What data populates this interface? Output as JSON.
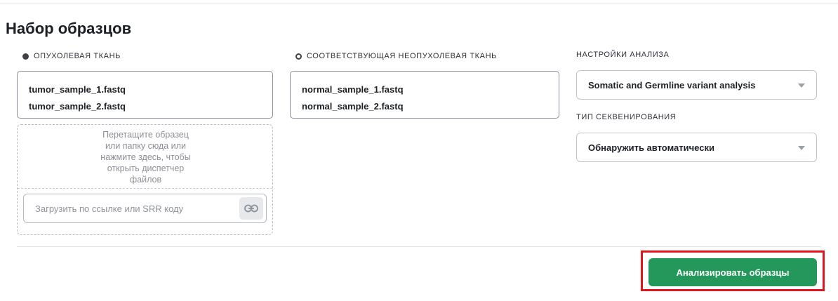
{
  "page": {
    "title": "Набор образцов"
  },
  "tumor": {
    "label": "ОПУХОЛЕВАЯ ТКАНЬ",
    "files": [
      "tumor_sample_1.fastq",
      "tumor_sample_2.fastq"
    ]
  },
  "normal": {
    "label": "СООТВЕТСТВУЮЩАЯ НЕОПУХОЛЕВАЯ ТКАНЬ",
    "files": [
      "normal_sample_1.fastq",
      "normal_sample_2.fastq"
    ]
  },
  "dropzone": {
    "lines": [
      "Перетащите образец",
      "или папку сюда или",
      "нажмите здесь, чтобы",
      "открыть диспетчер",
      "файлов"
    ],
    "url_placeholder": "Загрузить по ссылке или SRR коду",
    "link_icon": "link-icon"
  },
  "settings": {
    "analysis_label": "НАСТРОЙКИ АНАЛИЗА",
    "analysis_value": "Somatic and Germline variant analysis",
    "sequencing_label": "ТИП СЕКВЕНИРОВАНИЯ",
    "sequencing_value": "Обнаружить автоматически"
  },
  "actions": {
    "analyze_label": "Анализировать образцы"
  },
  "colors": {
    "primary_button": "#24985a",
    "highlight": "#e3151a"
  }
}
